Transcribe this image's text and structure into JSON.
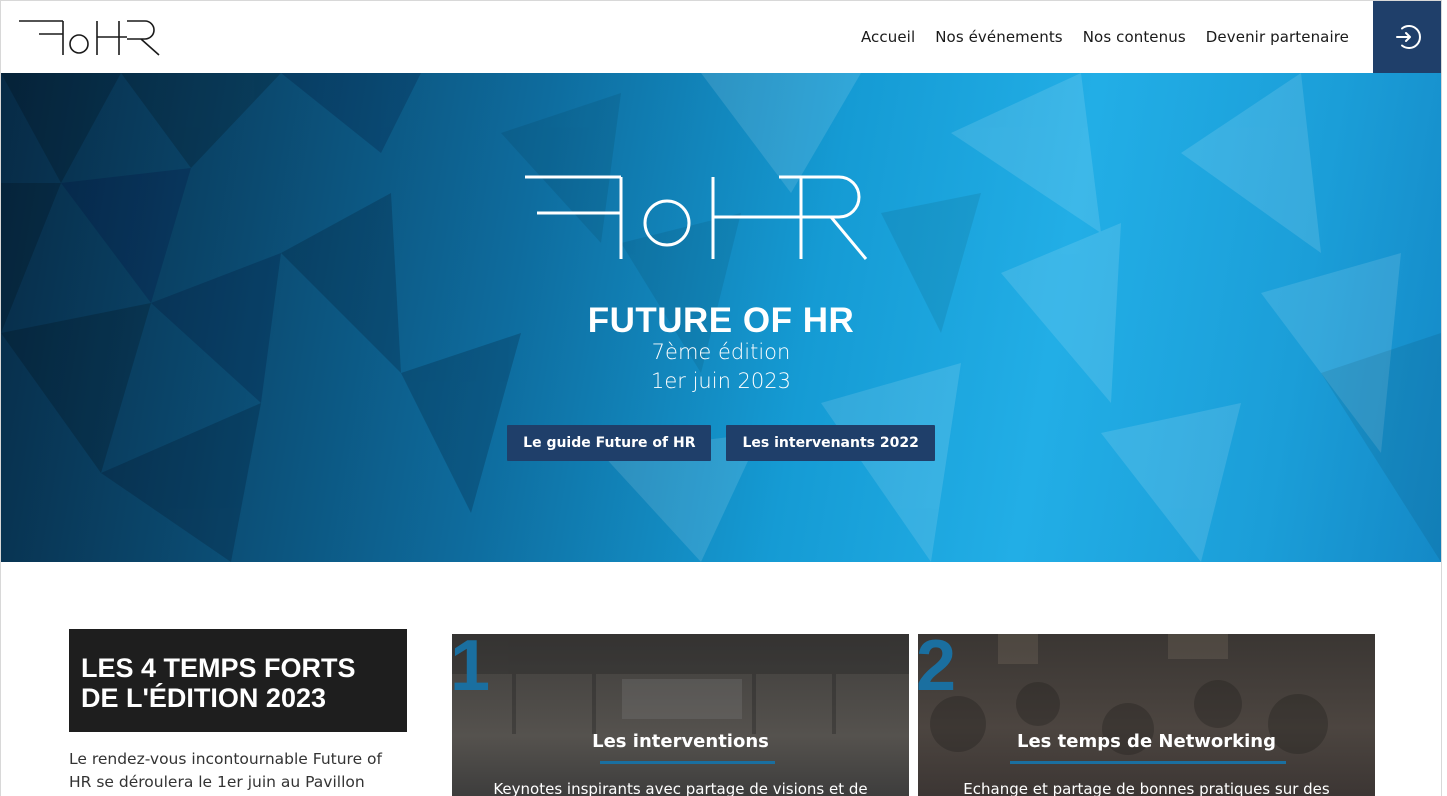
{
  "brand": {
    "logo_text": "FoHR"
  },
  "nav": {
    "items": [
      {
        "label": "Accueil"
      },
      {
        "label": "Nos événements"
      },
      {
        "label": "Nos contenus"
      },
      {
        "label": "Devenir partenaire"
      }
    ],
    "login_icon": "sign-in-icon"
  },
  "hero": {
    "title": "FUTURE OF HR",
    "edition": "7ème édition",
    "date": "1er juin 2023",
    "buttons": [
      {
        "label": "Le guide Future of HR"
      },
      {
        "label": "Les intervenants 2022"
      }
    ]
  },
  "highlights": {
    "title_line1": "LES 4 TEMPS FORTS",
    "title_line2": "DE L'ÉDITION 2023",
    "intro_line1": "Le rendez-vous incontournable Future of",
    "intro_line2": "HR se déroulera le 1er juin au Pavillon",
    "cards": [
      {
        "number": "1",
        "title": "Les interventions",
        "description": "Keynotes inspirants avec partage de visions et de"
      },
      {
        "number": "2",
        "title": "Les temps de Networking",
        "description": "Echange et partage de bonnes pratiques sur des"
      }
    ]
  },
  "colors": {
    "accent_navy": "#1f3f6a",
    "accent_blue": "#1a6fa0",
    "hero_blue": "#22aee6",
    "title_box": "#1e1e1e"
  }
}
